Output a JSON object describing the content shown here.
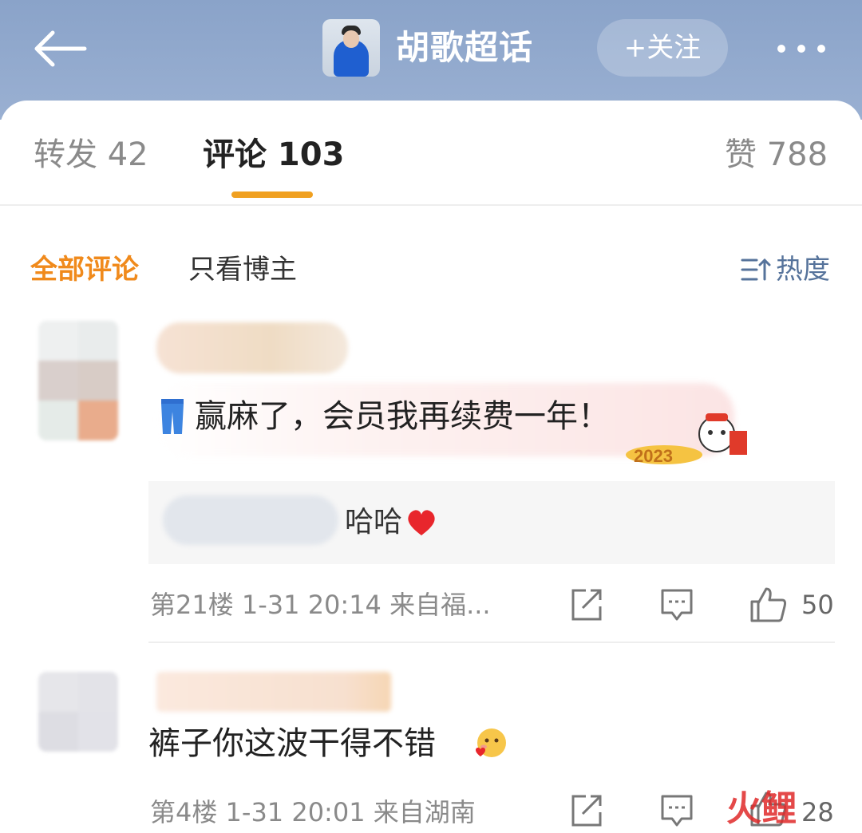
{
  "header": {
    "topic_title": "胡歌超话",
    "follow_label": "+关注",
    "back_icon": "arrow-left-icon",
    "more_icon": "more-dots-icon"
  },
  "tabs": [
    {
      "label": "转发 42"
    },
    {
      "label": "评论 103"
    },
    {
      "label": "赞 788"
    }
  ],
  "filters": {
    "all": "全部评论",
    "owner_only": "只看博主",
    "sort": "热度"
  },
  "comments": [
    {
      "text": "赢麻了，会员我再续费一年！",
      "reply": {
        "text": "哈哈"
      },
      "meta": "第21楼 1-31 20:14 来自福...",
      "likes": "50"
    },
    {
      "text": "裤子你这波干得不错",
      "meta": "第4楼 1-31 20:01 来自湖南",
      "likes": "28"
    }
  ],
  "watermark": "火鲤",
  "colors": {
    "accent": "#f08a1c",
    "header_bg": "#8aa3c9",
    "sort_blue": "#56739b"
  }
}
